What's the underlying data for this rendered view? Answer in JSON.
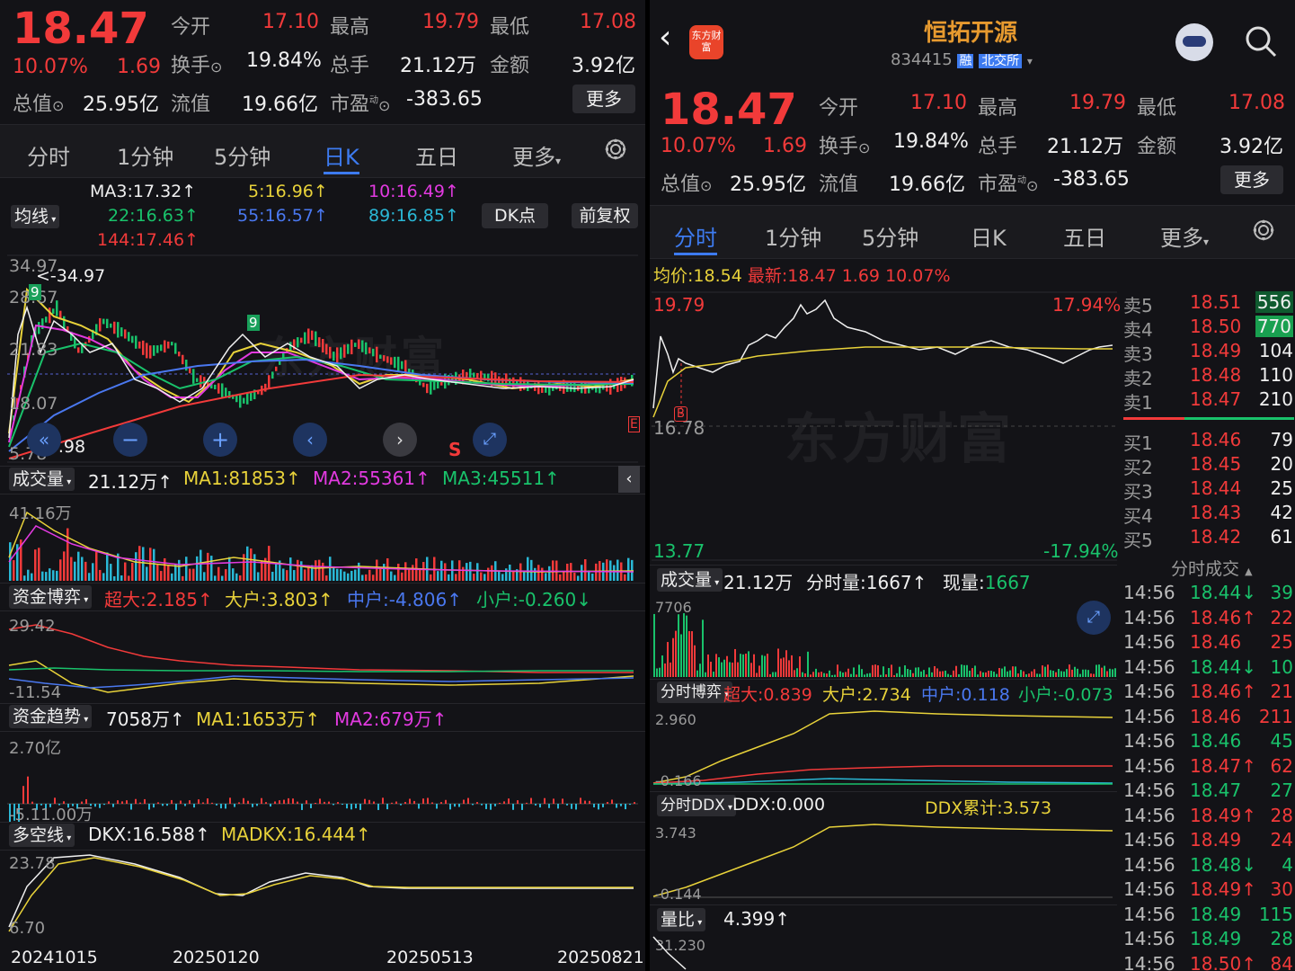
{
  "left": {
    "quote": {
      "price": "18.47",
      "change_pct": "10.07%",
      "change": "1.69",
      "open_label": "今开",
      "open": "17.10",
      "high_label": "最高",
      "high": "19.79",
      "low_label": "最低",
      "low": "17.08",
      "turnover_label": "换手",
      "turnover": "19.84%",
      "volume_label": "总手",
      "volume": "21.12万",
      "amount_label": "金额",
      "amount": "3.92亿",
      "mktcap_label": "总值",
      "mktcap": "25.95亿",
      "float_label": "流值",
      "float": "19.66亿",
      "pe_label": "市盈",
      "pe_sup": "动",
      "pe": "-383.65",
      "more": "更多"
    },
    "tabs": [
      "分时",
      "1分钟",
      "5分钟",
      "日K",
      "五日",
      "更多"
    ],
    "active_tab": "日K",
    "ma": {
      "selector": "均线",
      "ma3": "MA3:17.32",
      "ma5": "5:16.96",
      "ma10": "10:16.49",
      "ma22": "22:16.63",
      "ma55": "55:16.57",
      "ma89": "89:16.85",
      "ma144": "144:17.46",
      "dk_button": "DK点",
      "adjust_button": "前复权"
    },
    "kline": {
      "y_top": "34.97",
      "y_2": "28.67",
      "y_3": "21.83",
      "y_4": "18.07",
      "y_bottom": "5.78",
      "max_marker": "<-34.97",
      "min_marker": "<-7.98",
      "s_marker": "S",
      "e_marker": "E",
      "nine_marker_1": "9",
      "nine_marker_2": "9"
    },
    "volume": {
      "selector": "成交量",
      "value": "21.12万",
      "ma1": "MA1:81853",
      "ma2": "MA2:55361",
      "ma3": "MA3:45511",
      "y_top": "41.16万"
    },
    "capital_game": {
      "selector": "资金博弈",
      "super": "超大:2.185",
      "big": "大户:3.803",
      "mid": "中户:-4.806",
      "small": "小户:-0.260",
      "y_top": "29.42",
      "y_bottom": "-11.54"
    },
    "capital_trend": {
      "selector": "资金趋势",
      "value": "7058万",
      "ma1": "MA1:1653万",
      "ma2": "MA2:679万",
      "y_top": "2.70亿",
      "y_bottom": "-5.11.00万"
    },
    "dkx": {
      "selector": "多空线",
      "dkx": "DKX:16.588",
      "madkx": "MADKX:16.444",
      "y_top": "23.78",
      "y_bottom": "6.70"
    },
    "dates": [
      "20241015",
      "20250120",
      "20250513",
      "20250821"
    ]
  },
  "right": {
    "header": {
      "title": "恒拓开源",
      "code": "834415",
      "tag_rong": "融",
      "tag_exchange": "北交所",
      "logo_text": "东方财富"
    },
    "quote": {
      "price": "18.47",
      "change_pct": "10.07%",
      "change": "1.69",
      "open_label": "今开",
      "open": "17.10",
      "high_label": "最高",
      "high": "19.79",
      "low_label": "最低",
      "low": "17.08",
      "turnover_label": "换手",
      "turnover": "19.84%",
      "volume_label": "总手",
      "volume": "21.12万",
      "amount_label": "金额",
      "amount": "3.92亿",
      "mktcap_label": "总值",
      "mktcap": "25.95亿",
      "float_label": "流值",
      "float": "19.66亿",
      "pe_label": "市盈",
      "pe_sup": "动",
      "pe": "-383.65",
      "more": "更多"
    },
    "tabs": [
      "分时",
      "1分钟",
      "5分钟",
      "日K",
      "五日",
      "更多"
    ],
    "active_tab": "分时",
    "intraday": {
      "avg_label": "均价:",
      "avg": "18.54",
      "last_label": "最新:",
      "last": "18.47",
      "chg": "1.69",
      "chg_pct": "10.07%",
      "y_top": "19.79",
      "y_mid": "16.78",
      "y_bottom": "13.77",
      "pct_top": "17.94%",
      "pct_bottom": "-17.94%",
      "b_marker": "B"
    },
    "orderbook": {
      "asks": [
        {
          "label": "卖5",
          "price": "18.51",
          "vol": "556"
        },
        {
          "label": "卖4",
          "price": "18.50",
          "vol": "770"
        },
        {
          "label": "卖3",
          "price": "18.49",
          "vol": "104"
        },
        {
          "label": "卖2",
          "price": "18.48",
          "vol": "110"
        },
        {
          "label": "卖1",
          "price": "18.47",
          "vol": "210"
        }
      ],
      "bids": [
        {
          "label": "买1",
          "price": "18.46",
          "vol": "79"
        },
        {
          "label": "买2",
          "price": "18.45",
          "vol": "20"
        },
        {
          "label": "买3",
          "price": "18.44",
          "vol": "25"
        },
        {
          "label": "买4",
          "price": "18.43",
          "vol": "42"
        },
        {
          "label": "买5",
          "price": "18.42",
          "vol": "61"
        }
      ],
      "trades_title": "分时成交"
    },
    "trades": [
      {
        "time": "14:56",
        "price": "18.44↓",
        "vol": "39",
        "c": "green"
      },
      {
        "time": "14:56",
        "price": "18.46↑",
        "vol": "22",
        "c": "red"
      },
      {
        "time": "14:56",
        "price": "18.46",
        "vol": "25",
        "c": "red"
      },
      {
        "time": "14:56",
        "price": "18.44↓",
        "vol": "10",
        "c": "green"
      },
      {
        "time": "14:56",
        "price": "18.46↑",
        "vol": "21",
        "c": "red"
      },
      {
        "time": "14:56",
        "price": "18.46",
        "vol": "211",
        "c": "red"
      },
      {
        "time": "14:56",
        "price": "18.46",
        "vol": "45",
        "c": "green"
      },
      {
        "time": "14:56",
        "price": "18.47↑",
        "vol": "62",
        "c": "red"
      },
      {
        "time": "14:56",
        "price": "18.47",
        "vol": "27",
        "c": "green"
      },
      {
        "time": "14:56",
        "price": "18.49↑",
        "vol": "28",
        "c": "red"
      },
      {
        "time": "14:56",
        "price": "18.49",
        "vol": "24",
        "c": "red"
      },
      {
        "time": "14:56",
        "price": "18.48↓",
        "vol": "4",
        "c": "green"
      },
      {
        "time": "14:56",
        "price": "18.49↑",
        "vol": "30",
        "c": "red"
      },
      {
        "time": "14:56",
        "price": "18.49",
        "vol": "115",
        "c": "green"
      },
      {
        "time": "14:56",
        "price": "18.49",
        "vol": "28",
        "c": "green"
      },
      {
        "time": "14:56",
        "price": "18.50↑",
        "vol": "84",
        "c": "red"
      }
    ],
    "volume": {
      "selector": "成交量",
      "value": "21.12万",
      "bar_label": "分时量:",
      "bar_value": "1667",
      "now_label": "现量:",
      "now_value": "1667",
      "y_top": "7706"
    },
    "game": {
      "selector": "分时博弈",
      "super": "超大:0.839",
      "big": "大户:2.734",
      "mid": "中户:0.118",
      "small": "小户:-0.073",
      "y_top": "2.960",
      "y_bottom": "-0.166"
    },
    "ddx": {
      "selector": "分时DDX",
      "ddx": "DDX:0.000",
      "sum": "DDX累计:3.573",
      "y_top": "3.743",
      "y_bottom": "-0.144"
    },
    "ratio": {
      "selector": "量比",
      "value": "4.399",
      "y_top": "31.230"
    }
  },
  "colors": {
    "up": "#f23a3a",
    "down": "#19c26b",
    "accent": "#3d7bf0",
    "bg": "#131317"
  },
  "watermark": "东方财富"
}
